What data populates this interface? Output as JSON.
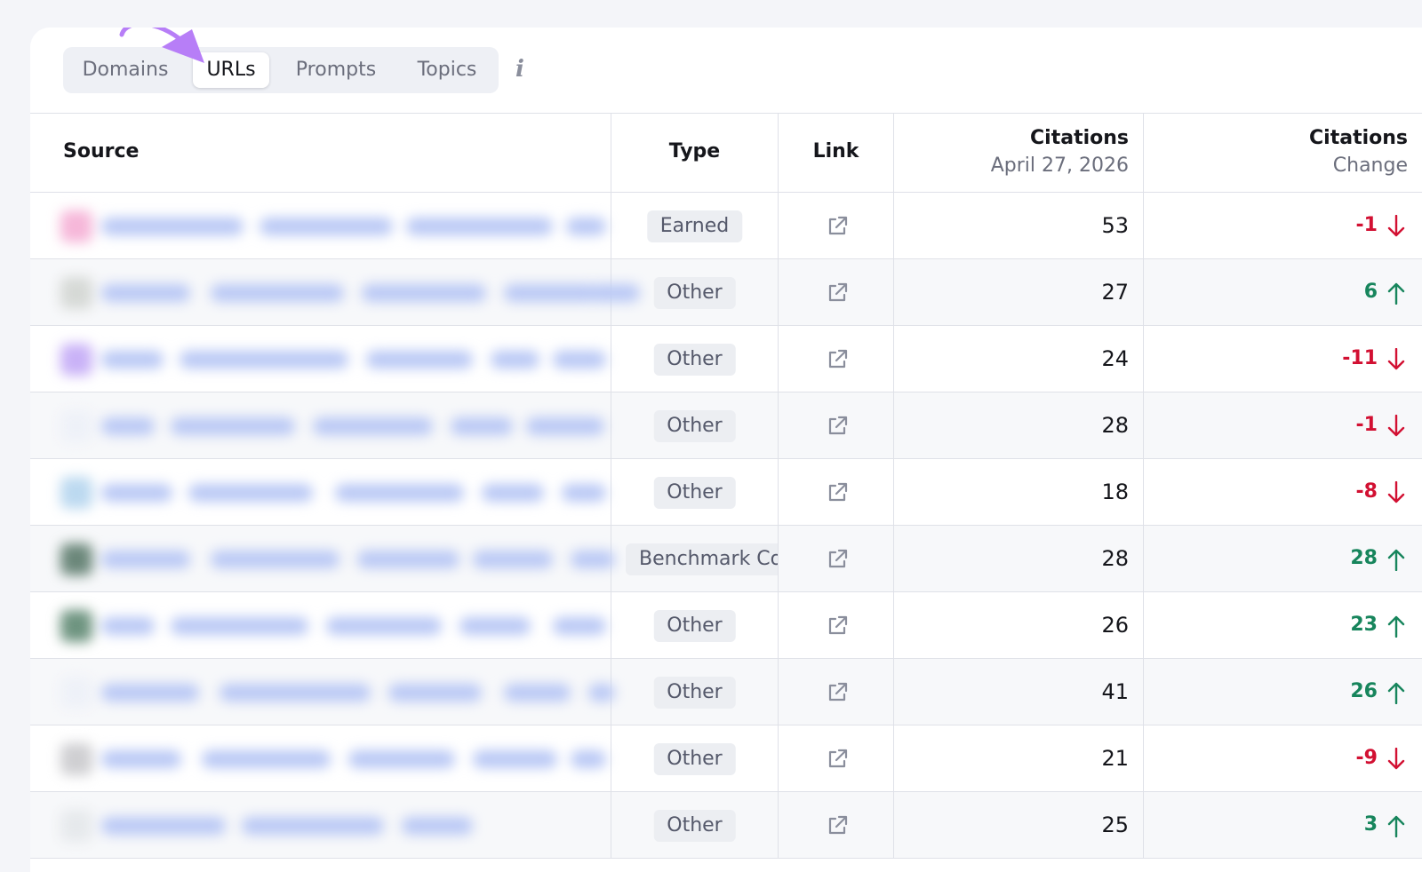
{
  "tabs": [
    {
      "label": "Domains",
      "active": false
    },
    {
      "label": "URLs",
      "active": true
    },
    {
      "label": "Prompts",
      "active": false
    },
    {
      "label": "Topics",
      "active": false
    }
  ],
  "info_icon": "info-icon",
  "columns": {
    "source": "Source",
    "type": "Type",
    "link": "Link",
    "citations_title": "Citations",
    "citations_date": "April 27, 2026",
    "change_title": "Citations",
    "change_sub": "Change"
  },
  "colors": {
    "accent_arrow": "#b77ef7",
    "negative": "#d21032",
    "positive": "#17855c"
  },
  "rows": [
    {
      "type": "Earned",
      "citations": "53",
      "change": "-1",
      "direction": "down",
      "favicon_color": "#f6b7d9"
    },
    {
      "type": "Other",
      "citations": "27",
      "change": "6",
      "direction": "up",
      "favicon_color": "#d6d9d6"
    },
    {
      "type": "Other",
      "citations": "24",
      "change": "-11",
      "direction": "down",
      "favicon_color": "#c9b2f7"
    },
    {
      "type": "Other",
      "citations": "28",
      "change": "-1",
      "direction": "down",
      "favicon_color": "#eef1f8"
    },
    {
      "type": "Other",
      "citations": "18",
      "change": "-8",
      "direction": "down",
      "favicon_color": "#bcd9f0"
    },
    {
      "type": "Benchmark Co",
      "citations": "28",
      "change": "28",
      "direction": "up",
      "favicon_color": "#6b877a"
    },
    {
      "type": "Other",
      "citations": "26",
      "change": "23",
      "direction": "up",
      "favicon_color": "#6e9480"
    },
    {
      "type": "Other",
      "citations": "41",
      "change": "26",
      "direction": "up",
      "favicon_color": "#eef1f8"
    },
    {
      "type": "Other",
      "citations": "21",
      "change": "-9",
      "direction": "down",
      "favicon_color": "#cfcfd2"
    },
    {
      "type": "Other",
      "citations": "25",
      "change": "3",
      "direction": "up",
      "favicon_color": "#e6e9ec"
    }
  ]
}
